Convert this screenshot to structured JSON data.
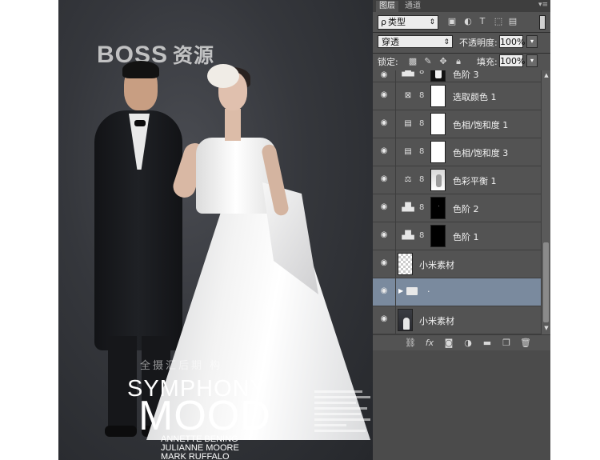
{
  "watermark": {
    "text": "BOSS",
    "cn": "资源"
  },
  "poster": {
    "faint_line": "全摄汇后期    构",
    "title_line1": "SYMPHONY",
    "title_line2": "MOOD",
    "names": [
      "ANNETTE BENING",
      "JULIANNE MOORE",
      "MARK RUFFALO"
    ]
  },
  "panel": {
    "tabs": [
      {
        "label": "图层",
        "active": true
      },
      {
        "label": "通道",
        "active": false
      }
    ],
    "menu_icon": "panel-menu-icon",
    "filter": {
      "search_glyph": "ρ",
      "label": "类型"
    },
    "blend_mode": "穿透",
    "opacity_label": "不透明度:",
    "opacity_value": "100%",
    "lock_label": "锁定:",
    "fill_label": "填充:",
    "fill_value": "100%",
    "layers": [
      {
        "name": "色阶 3",
        "type": "levels",
        "mask": "figure"
      },
      {
        "name": "选取颜色 1",
        "type": "selective-color",
        "mask": "white"
      },
      {
        "name": "色相/饱和度 1",
        "type": "hue-saturation",
        "mask": "white"
      },
      {
        "name": "色相/饱和度 3",
        "type": "hue-saturation",
        "mask": "white"
      },
      {
        "name": "色彩平衡 1",
        "type": "color-balance",
        "mask": "photo"
      },
      {
        "name": "色阶 2",
        "type": "levels",
        "mask": "black"
      },
      {
        "name": "色阶 1",
        "type": "levels",
        "mask": "black"
      },
      {
        "name": "小米素材",
        "type": "pixel-transparent"
      },
      {
        "name": ".",
        "type": "group",
        "selected": true
      },
      {
        "name": "小米素材",
        "type": "pixel-photo"
      }
    ],
    "bottom_icons": [
      "link-layers-icon",
      "fx-icon",
      "add-mask-icon",
      "new-adjustment-icon",
      "new-group-icon",
      "new-layer-icon",
      "delete-layer-icon"
    ]
  },
  "colors": {
    "panel_bg": "#535353",
    "selected_row": "#7a8a9e",
    "photo_bg": "#35373c"
  }
}
